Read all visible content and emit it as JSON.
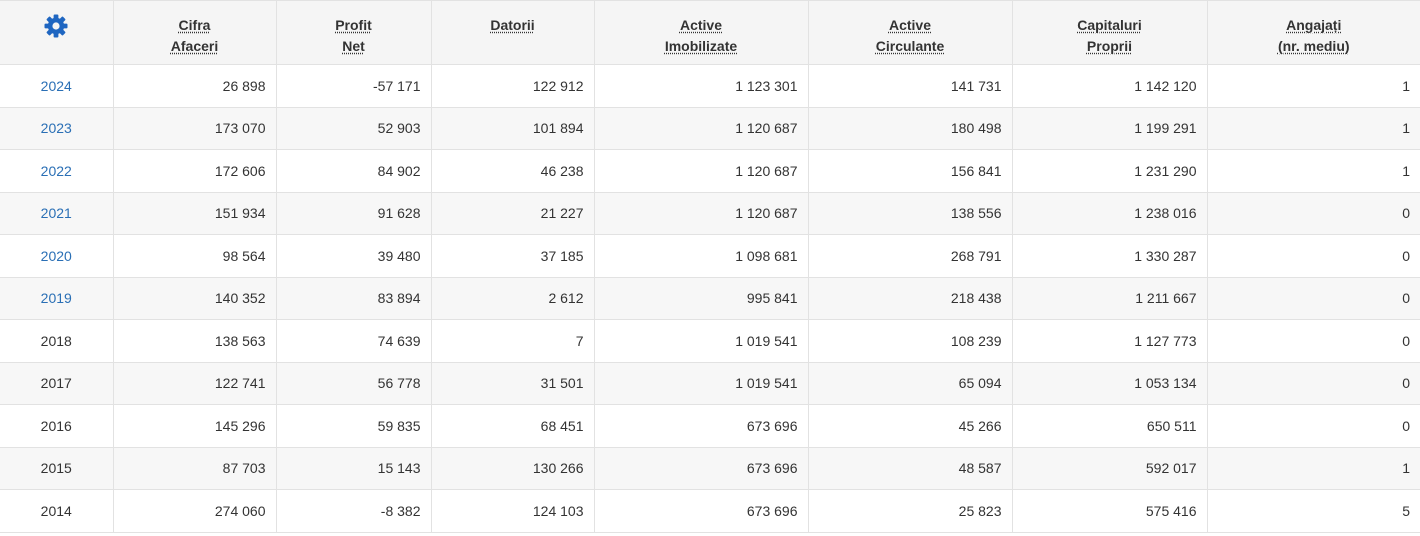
{
  "header": {
    "settings_icon": "gear-icon",
    "accent_color": "#1f66c1",
    "columns": [
      {
        "key": "ca",
        "line1": "Cifra",
        "line2": "Afaceri"
      },
      {
        "key": "pn",
        "line1": "Profit",
        "line2": "Net"
      },
      {
        "key": "dat",
        "line1": "Datorii",
        "line2": ""
      },
      {
        "key": "ai",
        "line1": "Active",
        "line2": "Imobilizate"
      },
      {
        "key": "ac",
        "line1": "Active",
        "line2": "Circulante"
      },
      {
        "key": "cp",
        "line1": "Capitaluri",
        "line2": "Proprii"
      },
      {
        "key": "ang",
        "line1": "Angajați",
        "line2": "(nr. mediu)"
      }
    ]
  },
  "rows": [
    {
      "year": "2024",
      "linked": true,
      "ca": "26 898",
      "pn": "-57 171",
      "dat": "122 912",
      "ai": "1 123 301",
      "ac": "141 731",
      "cp": "1 142 120",
      "ang": "1"
    },
    {
      "year": "2023",
      "linked": true,
      "ca": "173 070",
      "pn": "52 903",
      "dat": "101 894",
      "ai": "1 120 687",
      "ac": "180 498",
      "cp": "1 199 291",
      "ang": "1"
    },
    {
      "year": "2022",
      "linked": true,
      "ca": "172 606",
      "pn": "84 902",
      "dat": "46 238",
      "ai": "1 120 687",
      "ac": "156 841",
      "cp": "1 231 290",
      "ang": "1"
    },
    {
      "year": "2021",
      "linked": true,
      "ca": "151 934",
      "pn": "91 628",
      "dat": "21 227",
      "ai": "1 120 687",
      "ac": "138 556",
      "cp": "1 238 016",
      "ang": "0"
    },
    {
      "year": "2020",
      "linked": true,
      "ca": "98 564",
      "pn": "39 480",
      "dat": "37 185",
      "ai": "1 098 681",
      "ac": "268 791",
      "cp": "1 330 287",
      "ang": "0"
    },
    {
      "year": "2019",
      "linked": true,
      "ca": "140 352",
      "pn": "83 894",
      "dat": "2 612",
      "ai": "995 841",
      "ac": "218 438",
      "cp": "1 211 667",
      "ang": "0"
    },
    {
      "year": "2018",
      "linked": false,
      "ca": "138 563",
      "pn": "74 639",
      "dat": "7",
      "ai": "1 019 541",
      "ac": "108 239",
      "cp": "1 127 773",
      "ang": "0"
    },
    {
      "year": "2017",
      "linked": false,
      "ca": "122 741",
      "pn": "56 778",
      "dat": "31 501",
      "ai": "1 019 541",
      "ac": "65 094",
      "cp": "1 053 134",
      "ang": "0"
    },
    {
      "year": "2016",
      "linked": false,
      "ca": "145 296",
      "pn": "59 835",
      "dat": "68 451",
      "ai": "673 696",
      "ac": "45 266",
      "cp": "650 511",
      "ang": "0"
    },
    {
      "year": "2015",
      "linked": false,
      "ca": "87 703",
      "pn": "15 143",
      "dat": "130 266",
      "ai": "673 696",
      "ac": "48 587",
      "cp": "592 017",
      "ang": "1"
    },
    {
      "year": "2014",
      "linked": false,
      "ca": "274 060",
      "pn": "-8 382",
      "dat": "124 103",
      "ai": "673 696",
      "ac": "25 823",
      "cp": "575 416",
      "ang": "5"
    }
  ]
}
